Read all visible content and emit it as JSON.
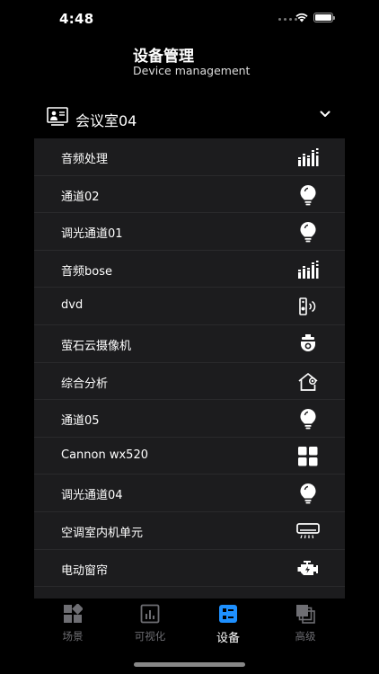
{
  "status_bar": {
    "time": "4:48"
  },
  "header": {
    "title": "设备管理",
    "subtitle": "Device management"
  },
  "room": {
    "name": "会议室04"
  },
  "devices": [
    {
      "name": "音频处理",
      "icon": "audio-bars-icon"
    },
    {
      "name": "通道02",
      "icon": "bulb-icon"
    },
    {
      "name": "调光通道01",
      "icon": "bulb-icon"
    },
    {
      "name": "音频bose",
      "icon": "audio-bars-icon"
    },
    {
      "name": "dvd",
      "icon": "speaker-icon"
    },
    {
      "name": "萤石云摄像机",
      "icon": "dome-camera-icon"
    },
    {
      "name": "综合分析",
      "icon": "smart-home-icon"
    },
    {
      "name": "通道05",
      "icon": "bulb-icon"
    },
    {
      "name": "Cannon wx520",
      "icon": "grid-icon"
    },
    {
      "name": "调光通道04",
      "icon": "bulb-icon"
    },
    {
      "name": "空调室内机单元",
      "icon": "air-conditioner-icon"
    },
    {
      "name": "电动窗帘",
      "icon": "motor-icon"
    }
  ],
  "tabs": [
    {
      "label": "场景",
      "icon": "scene-icon",
      "active": false
    },
    {
      "label": "可视化",
      "icon": "chart-icon",
      "active": false
    },
    {
      "label": "设备",
      "icon": "device-icon",
      "active": true
    },
    {
      "label": "高级",
      "icon": "advanced-icon",
      "active": false
    }
  ],
  "colors": {
    "background": "#000000",
    "list_bg": "#1c1c1e",
    "active_tab": "#1e90ff",
    "inactive_tab": "#6e6e73"
  }
}
